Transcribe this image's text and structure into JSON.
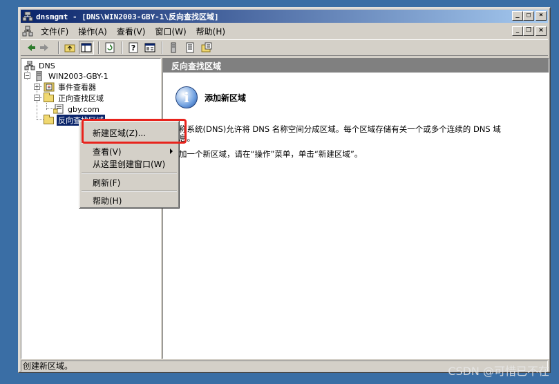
{
  "window": {
    "title": "dnsmgmt - [DNS\\WIN2003-GBY-1\\反向查找区域]"
  },
  "menubar": {
    "items": [
      "文件(F)",
      "操作(A)",
      "查看(V)",
      "窗口(W)",
      "帮助(H)"
    ]
  },
  "toolbar": {
    "icons": [
      "back-icon",
      "forward-icon",
      "up-folder-icon",
      "show-hide-tree-icon",
      "refresh-icon",
      "help-icon",
      "properties-icon",
      "server-icon",
      "list-icon",
      "zone-icon"
    ]
  },
  "tree": {
    "root": "DNS",
    "server": "WIN2003-GBY-1",
    "event_viewer": "事件查看器",
    "forward_zones": "正向查找区域",
    "forward_zone_item": "gby.com",
    "reverse_zones": "反向查找区域"
  },
  "right_pane": {
    "header": "反向查找区域",
    "info_title": "添加新区域",
    "description_line1": "域名称系统(DNS)允许将 DNS 名称空间分成区域。每个区域存储有关一个或多个连续的 DNS 域",
    "description_line2": "的信息。",
    "description_line3": "要添加一个新区域，请在“操作”菜单，单击“新建区域”。"
  },
  "context_menu": {
    "new_zone": "新建区域(Z)...",
    "view": "查看(V)",
    "new_window": "从这里创建窗口(W)",
    "refresh": "刷新(F)",
    "help": "帮助(H)"
  },
  "statusbar": {
    "text": "创建新区域。"
  },
  "watermark": "CSDN @可惜已不在",
  "colors": {
    "desktop": "#3a6ea5",
    "titlebar": "#0a246a",
    "highlight": "#e8231c"
  }
}
